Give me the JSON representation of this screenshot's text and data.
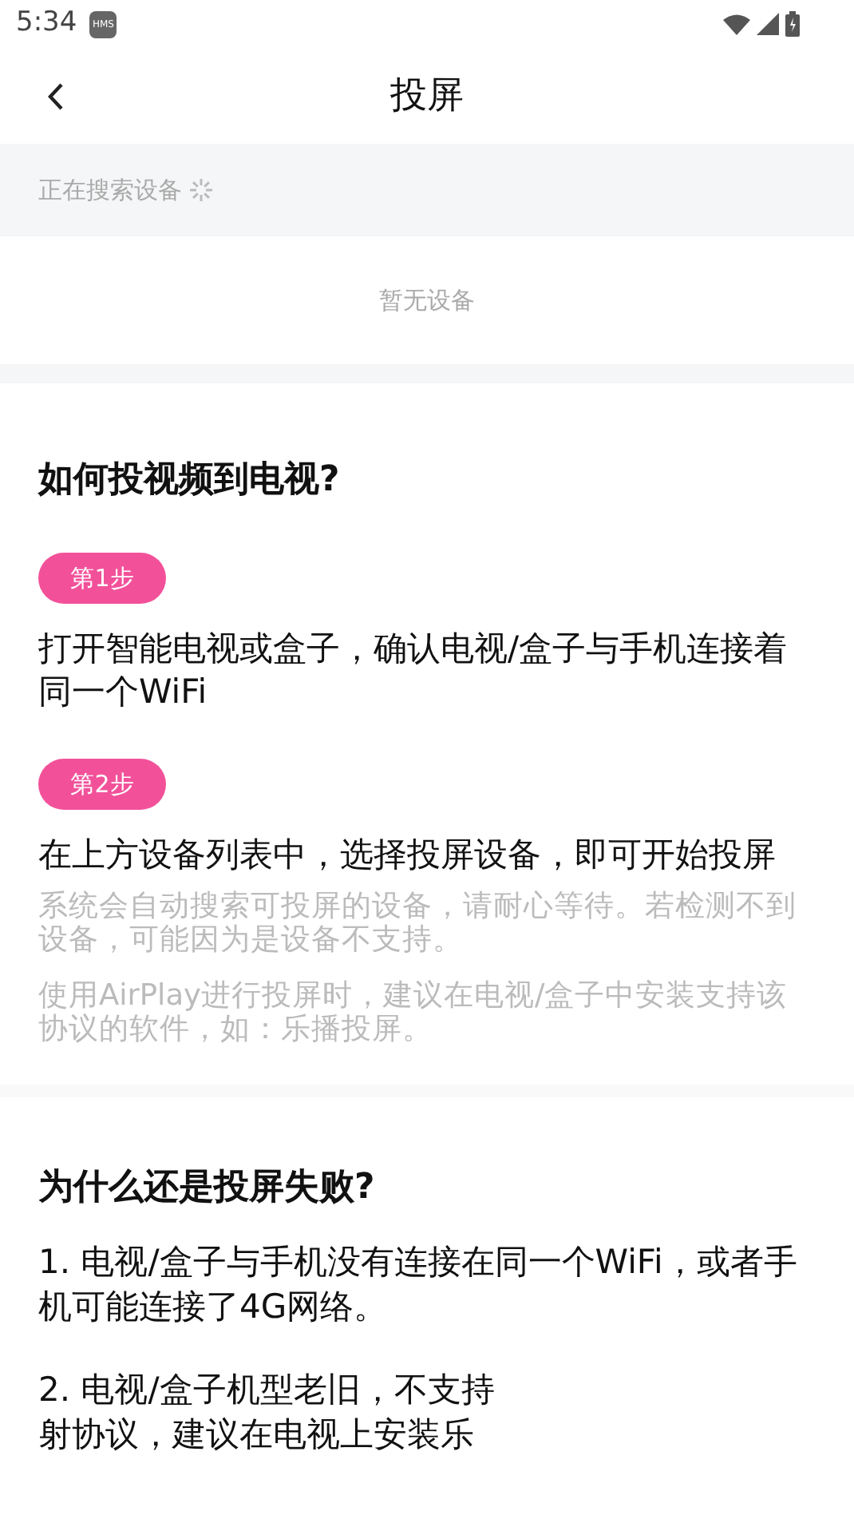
{
  "status_bar": {
    "time": "5:34",
    "app_badge": "HMS"
  },
  "header": {
    "title": "投屏"
  },
  "search": {
    "status": "正在搜索设备",
    "searching": true,
    "empty_text": "暂无设备"
  },
  "guide": {
    "title": "如何投视频到电视?",
    "steps": [
      {
        "badge": "第1步",
        "text": "打开智能电视或盒子，确认电视/盒子与手机连接着同一个WiFi"
      },
      {
        "badge": "第2步",
        "text": "在上方设备列表中，选择投屏设备，即可开始投屏",
        "notes": [
          "系统会自动搜索可投屏的设备，请耐心等待。若检测不到设备，可能因为是设备不支持。",
          "使用AirPlay进行投屏时，建议在电视/盒子中安装支持该协议的软件，如：乐播投屏。"
        ]
      }
    ]
  },
  "faq": {
    "title": "为什么还是投屏失败?",
    "items": [
      {
        "lines": [
          "1. 电视/盒子与手机没有连接在同一个WiFi，或者手机可能连接了4G网络。"
        ]
      },
      {
        "lines": [
          "2. 电视/盒子机型老旧，不支持",
          "射协议，建议在电视上安装乐"
        ]
      }
    ]
  }
}
